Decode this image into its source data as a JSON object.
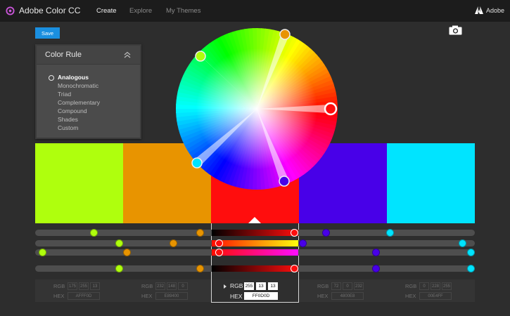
{
  "app": {
    "title": "Adobe Color CC",
    "brand": "Adobe"
  },
  "nav": [
    {
      "label": "Create",
      "active": true
    },
    {
      "label": "Explore",
      "active": false
    },
    {
      "label": "My Themes",
      "active": false
    }
  ],
  "toolbar": {
    "save_label": "Save"
  },
  "color_rule": {
    "title": "Color Rule",
    "options": [
      "Analogous",
      "Monochromatic",
      "Triad",
      "Complementary",
      "Compound",
      "Shades",
      "Custom"
    ],
    "selected": "Analogous"
  },
  "swatches": [
    {
      "rgb": [
        "175",
        "255",
        "13"
      ],
      "hex": "AFFF0D",
      "color": "#AFFF0D"
    },
    {
      "rgb": [
        "232",
        "148",
        "0"
      ],
      "hex": "E89400",
      "color": "#E89400"
    },
    {
      "rgb": [
        "255",
        "13",
        "13"
      ],
      "hex": "FF0D0D",
      "color": "#FF0D0D"
    },
    {
      "rgb": [
        "72",
        "0",
        "232"
      ],
      "hex": "4800E8",
      "color": "#4800E8"
    },
    {
      "rgb": [
        "0",
        "228",
        "255"
      ],
      "hex": "00E4FF",
      "color": "#00E4FF"
    }
  ],
  "active_swatch": 2,
  "labels": {
    "rgb": "RGB",
    "hex": "HEX"
  },
  "icons": [
    "adobe-color-logo-icon",
    "adobe-logo-icon",
    "camera-icon",
    "collapse-chevron-icon",
    "radio-selected-icon",
    "pointer-triangle-icon"
  ]
}
